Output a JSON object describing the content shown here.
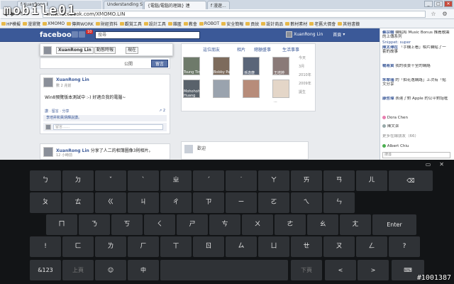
{
  "browser": {
    "tabs": [
      "f XuanRong Lin",
      "Understanding Simple M",
      "{電腦/電腦的理論} 連",
      "f 漫遊..."
    ],
    "url": "www.facebook.com/XMOMO.LIN",
    "bookmarks": [
      "HP模擬",
      "漫瀏覽",
      "XMOMO",
      "傳興WORK",
      "財經資料",
      "觀賞工具",
      "設計工具",
      "雜匿",
      "教會",
      "ROBOT",
      "安全簡報",
      "貢紋",
      "設計商品",
      "數材素材",
      "老舊大價會",
      "其他書籤"
    ]
  },
  "facebook": {
    "logo": "facebook",
    "notifications": "10",
    "search_placeholder": "搜尋",
    "user_name": "XuanRong Lin",
    "home_label": "首頁",
    "composer": {
      "name": "XuanRong Lin",
      "timeline_select": "動態時報",
      "time_select": "現在",
      "public_select": "公開",
      "post_button": "留言"
    },
    "profile_nav": [
      "這位朋友",
      "相片",
      "總額盛事",
      "生活事事"
    ],
    "friends": [
      "Tsung Ting",
      "Bobby Pan",
      "孫逸塵",
      "王培婷",
      "Mohohoho Huang",
      "七金剛頭",
      "楊秀芳",
      "..."
    ],
    "side_info": [
      "今天",
      "3月",
      "2010年",
      "2009年",
      "誕生"
    ],
    "post1": {
      "name": "XuanRong Lin",
      "meta": "數 2 兆前",
      "text": "Win8預覽版本測試中 :-) 好適合我的電腦~",
      "actions": "讚 · 留言 · 分享",
      "likes": "2",
      "liked_by": "李培昇和黃炳輝說讚。",
      "comment_placeholder": "留言……"
    },
    "post2": {
      "name": "XuanRong Lin",
      "text": "分享了人二的相簿圖像3則相片。",
      "meta": "12 小時前"
    },
    "bottom_box": "歡迎"
  },
  "chat": {
    "ticker": [
      {
        "name": "蔡宗翰",
        "text": "轉貼和 Music Bonus 推薦歌曲的上傳系列"
      },
      {
        "name": "陳太璋在",
        "text": "「手機上看」相片轉貼了一套的故事"
      },
      {
        "name": "楊易寅",
        "text": "我的夜景十全的網絡"
      },
      {
        "name": "朱翠瑞",
        "text": "的「拍花逸網路」上次有「貼文分享"
      },
      {
        "name": "康哲瑋",
        "text": "表達了對 Apple 的公平對話框"
      }
    ],
    "snippet": "Snippet: super",
    "contacts": [
      "Dora Chen",
      "陳文潔",
      "其他 (66)",
      "Albert Chiu"
    ],
    "more_online": "更多在線朋友（66）",
    "search_placeholder": "搜尋"
  },
  "keyboard": {
    "rows": [
      [
        "ㄅ",
        "ㄉ",
        "ˇ",
        "ˋ",
        "ㄓ",
        "ˊ",
        "˙",
        "ㄚ",
        "ㄞ",
        "ㄢ",
        "ㄦ"
      ],
      [
        "ㄆ",
        "ㄊ",
        "ㄍ",
        "ㄐ",
        "ㄔ",
        "ㄗ",
        "ㄧ",
        "ㄛ",
        "ㄟ",
        "ㄣ"
      ],
      [
        "ㄇ",
        "ㄋ",
        "ㄎ",
        "ㄑ",
        "ㄕ",
        "ㄘ",
        "ㄨ",
        "ㄜ",
        "ㄠ",
        "ㄤ"
      ],
      [
        "!",
        "ㄈ",
        "ㄌ",
        "ㄏ",
        "ㄒ",
        "ㄖ",
        "ㄙ",
        "ㄩ",
        "ㄝ",
        "ㄡ",
        "ㄥ",
        "?"
      ]
    ],
    "enter_label": "Enter",
    "backspace_symbol": "⌫",
    "sym_label": "&123",
    "prev_label": "上頁",
    "emoji_label": "☺",
    "lang_label": "中",
    "next_label": "下頁",
    "left_label": "<",
    "right_label": ">",
    "keyboard_icon": "⌨"
  },
  "watermark": {
    "text": "mobile01",
    "topic": "#1001387"
  }
}
